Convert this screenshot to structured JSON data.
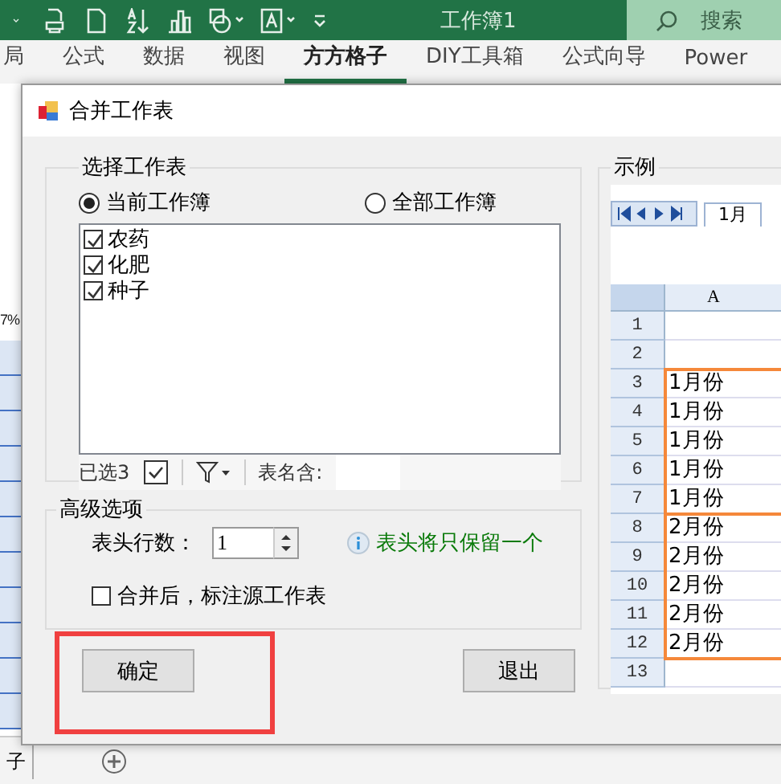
{
  "title_bar": {
    "title": "工作簿1",
    "search": "搜索"
  },
  "ribbon_tabs": [
    {
      "label": "局",
      "selected": false
    },
    {
      "label": "公式",
      "selected": false
    },
    {
      "label": "数据",
      "selected": false
    },
    {
      "label": "视图",
      "selected": false
    },
    {
      "label": "方方格子",
      "selected": true
    },
    {
      "label": "DIY工具箱",
      "selected": false
    },
    {
      "label": "公式向导",
      "selected": false
    },
    {
      "label": "Power",
      "selected": false
    }
  ],
  "left_cells": [
    "7%"
  ],
  "sheet_tabs": [
    "子"
  ],
  "dialog": {
    "title": "合并工作表",
    "select_group": {
      "legend": "选择工作表",
      "scopes": [
        {
          "label": "当前工作簿",
          "selected": true
        },
        {
          "label": "全部工作簿",
          "selected": false
        }
      ],
      "sheets": [
        {
          "name": "农药",
          "checked": true
        },
        {
          "name": "化肥",
          "checked": true
        },
        {
          "name": "种子",
          "checked": true
        }
      ],
      "selected_count": "已选3",
      "name_filter_label": "表名含:"
    },
    "advanced": {
      "legend": "高级选项",
      "header_rows_label": "表头行数：",
      "header_rows": "1",
      "hint": "表头将只保留一个",
      "mark_source": {
        "label": "合并后，标注源工作表",
        "checked": false
      }
    },
    "buttons": [
      "确定",
      "退出"
    ],
    "preview": {
      "legend": "示例",
      "tab": "1月",
      "column": "A",
      "blank_rows": [
        {
          "number": "1"
        },
        {
          "number": "2"
        }
      ],
      "groups": [
        {
          "rows": [
            {
              "number": "3",
              "value": "1月份"
            },
            {
              "number": "4",
              "value": "1月份"
            },
            {
              "number": "5",
              "value": "1月份"
            },
            {
              "number": "6",
              "value": "1月份"
            },
            {
              "number": "7",
              "value": "1月份"
            }
          ]
        },
        {
          "rows": [
            {
              "number": "8",
              "value": "2月份"
            },
            {
              "number": "9",
              "value": "2月份"
            },
            {
              "number": "10",
              "value": "2月份"
            },
            {
              "number": "11",
              "value": "2月份"
            },
            {
              "number": "12",
              "value": "2月份"
            }
          ]
        }
      ],
      "tail_rows": [
        {
          "number": "13"
        }
      ]
    }
  }
}
